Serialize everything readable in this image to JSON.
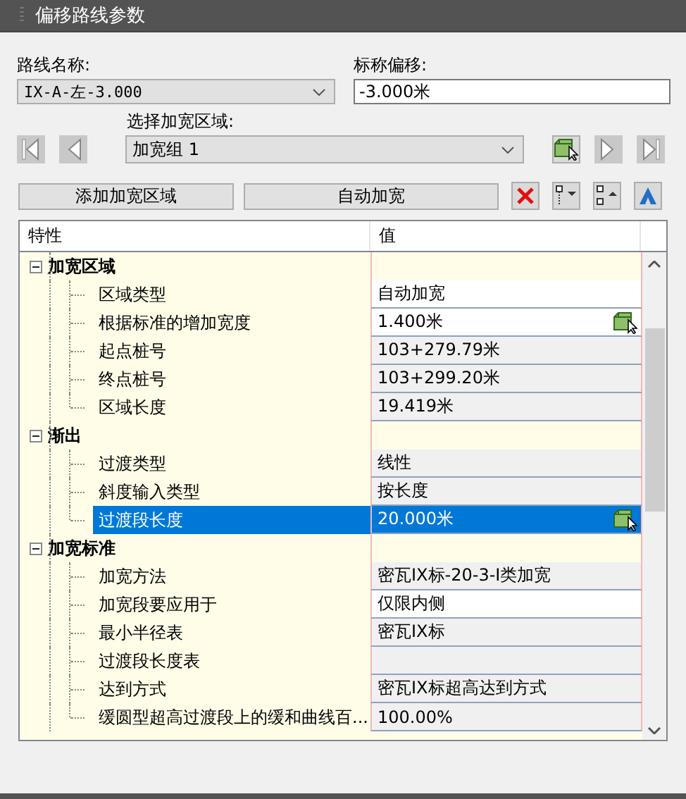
{
  "window": {
    "title": "偏移路线参数"
  },
  "route_name": {
    "label": "路线名称:",
    "value": "IX-A-左-3.000"
  },
  "nominal_offset": {
    "label": "标称偏移:",
    "value": "-3.000米"
  },
  "region_select": {
    "label": "选择加宽区域:",
    "value": "加宽组 1"
  },
  "buttons": [
    "添加加宽区域",
    "自动加宽"
  ],
  "table": {
    "columns": [
      "特性",
      "值"
    ],
    "groups": [
      {
        "name": "加宽区域",
        "expanded": true,
        "children": [
          {
            "name": "区域类型",
            "value": "自动加宽",
            "editable": true,
            "selected": false,
            "pick": false
          },
          {
            "name": "根据标准的增加宽度",
            "value": "1.400米",
            "editable": true,
            "selected": false,
            "pick": true
          },
          {
            "name": "起点桩号",
            "value": "103+279.79米",
            "editable": false,
            "selected": false,
            "pick": false
          },
          {
            "name": "终点桩号",
            "value": "103+299.20米",
            "editable": false,
            "selected": false,
            "pick": false
          },
          {
            "name": "区域长度",
            "value": "19.419米",
            "editable": false,
            "selected": false,
            "pick": false
          }
        ]
      },
      {
        "name": "渐出",
        "expanded": true,
        "children": [
          {
            "name": "过渡类型",
            "value": "线性",
            "editable": false,
            "selected": false,
            "pick": false
          },
          {
            "name": "斜度输入类型",
            "value": "按长度",
            "editable": false,
            "selected": false,
            "pick": false
          },
          {
            "name": "过渡段长度",
            "value": "20.000米",
            "editable": true,
            "selected": true,
            "pick": true
          }
        ]
      },
      {
        "name": "加宽标准",
        "expanded": true,
        "children": [
          {
            "name": "加宽方法",
            "value": "密瓦IX标-20-3-I类加宽",
            "editable": false,
            "selected": false,
            "pick": false
          },
          {
            "name": "加宽段要应用于",
            "value": "仅限内侧",
            "editable": true,
            "selected": false,
            "pick": false
          },
          {
            "name": "最小半径表",
            "value": "密瓦IX标",
            "editable": false,
            "selected": false,
            "pick": false
          },
          {
            "name": "过渡段长度表",
            "editable": false,
            "selected": false,
            "pick": false
          },
          {
            "name": "达到方式",
            "value": "密瓦IX标超高达到方式",
            "editable": false,
            "selected": false,
            "pick": false
          },
          {
            "name": "缓圆型超高过渡段上的缓和曲线百...",
            "value": "100.00%",
            "editable": false,
            "selected": false,
            "pick": false
          }
        ]
      }
    ]
  }
}
